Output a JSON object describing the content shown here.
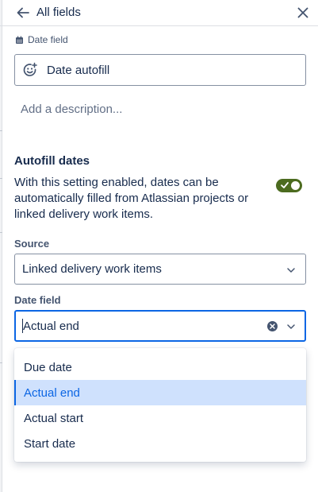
{
  "header": {
    "back_label": "All fields",
    "back_icon": "arrow-left-icon",
    "close_icon": "close-icon"
  },
  "field": {
    "type_icon": "calendar-icon",
    "type_label": "Date field",
    "name_icon": "smiley-icon",
    "name_value": "Date autofill",
    "description_placeholder": "Add a description..."
  },
  "autofill": {
    "title": "Autofill dates",
    "description": "With this setting enabled, dates can be automatically filled from Atlassian projects or linked delivery work items.",
    "enabled": true,
    "toggle_color": "#4c6b1f"
  },
  "source": {
    "label": "Source",
    "value": "Linked delivery work items"
  },
  "date_field": {
    "label": "Date field",
    "value": "Actual end",
    "options": [
      "Due date",
      "Actual end",
      "Actual start",
      "Start date"
    ],
    "selected": "Actual end"
  },
  "colors": {
    "accent": "#0c66e4",
    "selected_bg": "#cfe1fd",
    "text": "#172b4d",
    "subtle_text": "#626f86"
  }
}
